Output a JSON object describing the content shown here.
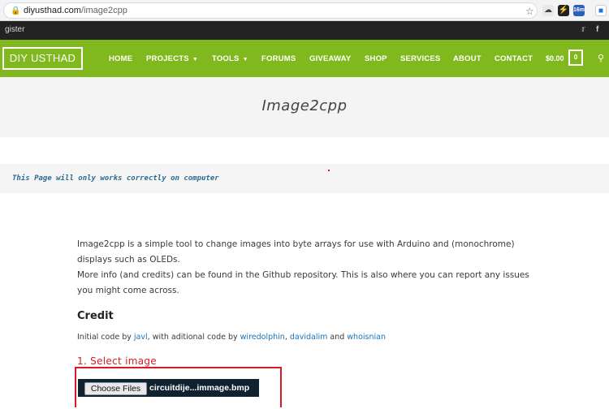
{
  "browser": {
    "url_domain": "diyusthad.com",
    "url_path": "/image2cpp",
    "extension_badge": "16m"
  },
  "topbar": {
    "cut_text": "gister",
    "social_icons": [
      "twitter-icon",
      "facebook-icon"
    ]
  },
  "nav": {
    "logo": "DIY USTHAD",
    "items": [
      {
        "label": "HOME",
        "has_dropdown": false
      },
      {
        "label": "PROJECTS",
        "has_dropdown": true
      },
      {
        "label": "TOOLS",
        "has_dropdown": true
      },
      {
        "label": "FORUMS",
        "has_dropdown": false
      },
      {
        "label": "GIVEAWAY",
        "has_dropdown": false
      },
      {
        "label": "SHOP",
        "has_dropdown": false
      },
      {
        "label": "SERVICES",
        "has_dropdown": false
      },
      {
        "label": "ABOUT",
        "has_dropdown": false
      },
      {
        "label": "CONTACT",
        "has_dropdown": false
      }
    ],
    "cart_total": "$0.00",
    "cart_count": "0"
  },
  "page": {
    "title": "Image2cpp",
    "notice": "This Page will only works correctly on computer",
    "intro_line1": "Image2cpp is a simple tool to change images into byte arrays for use with Arduino and (monochrome) displays such as OLEDs.",
    "intro_line2": "More info (and credits) can be found in the Github repository. This is also where you can report any issues you might come across.",
    "credit_heading": "Credit",
    "credit": {
      "prefix": "Initial code by ",
      "author1": "javl",
      "middle": ", with aditional code by ",
      "author2": "wiredolphin",
      "sep": ", ",
      "author3": "davidalim",
      "and": " and ",
      "author4": "whoisnian"
    },
    "step1_label": "1. Select image",
    "choose_files_label": "Choose Files",
    "selected_file": "circuitdije...immage.bmp"
  },
  "colors": {
    "nav_green": "#80b81d",
    "topbar_dark": "#232323",
    "link_blue": "#1a73b8",
    "step_red": "#d21f1f"
  }
}
